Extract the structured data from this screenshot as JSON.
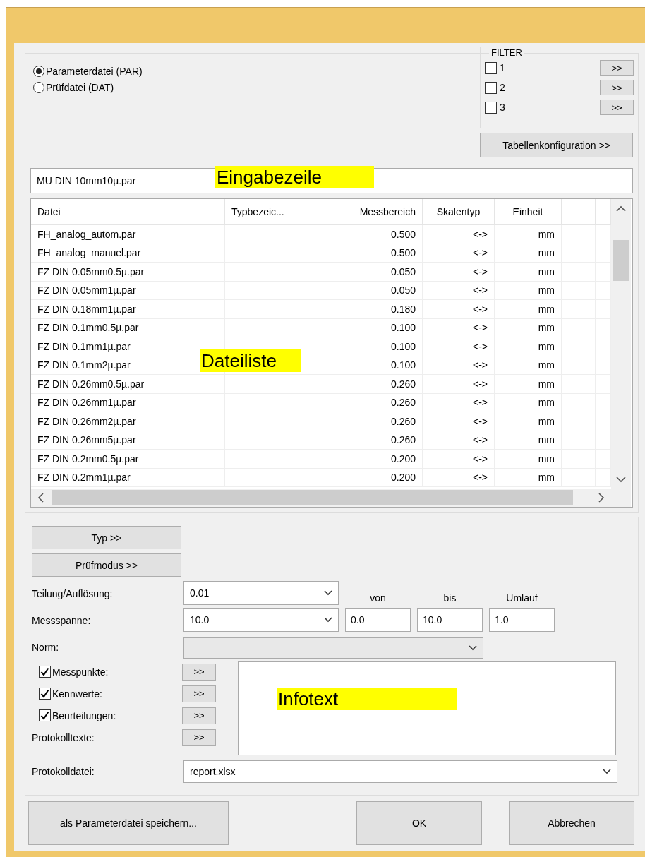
{
  "file_type": [
    {
      "label": "Parameterdatei (PAR)",
      "selected": true
    },
    {
      "label": "Prüfdatei (DAT)",
      "selected": false
    }
  ],
  "filter": {
    "title": "FILTER",
    "items": [
      {
        "label": "1",
        "checked": false,
        "button": ">>"
      },
      {
        "label": "2",
        "checked": false,
        "button": ">>"
      },
      {
        "label": "3",
        "checked": false,
        "button": ">>"
      }
    ]
  },
  "table_config_button": "Tabellenkonfiguration >>",
  "input_line": {
    "value": "MU DIN 10mm10µ.par"
  },
  "table": {
    "columns": [
      {
        "label": "Datei",
        "kind": "text"
      },
      {
        "label": "Typbezeic...",
        "kind": "text"
      },
      {
        "label": "Messbereich",
        "kind": "number"
      },
      {
        "label": "Skalentyp",
        "kind": "symbol"
      },
      {
        "label": "Einheit",
        "kind": "symbol"
      },
      {
        "kind": "text"
      }
    ],
    "rows": [
      [
        "FH_analog_autom.par",
        "",
        "0.500",
        "<->",
        "mm",
        ""
      ],
      [
        "FH_analog_manuel.par",
        "",
        "0.500",
        "<->",
        "mm",
        ""
      ],
      [
        "FZ DIN 0.05mm0.5µ.par",
        "",
        "0.050",
        "<->",
        "mm",
        ""
      ],
      [
        "FZ DIN 0.05mm1µ.par",
        "",
        "0.050",
        "<->",
        "mm",
        ""
      ],
      [
        "FZ DIN 0.18mm1µ.par",
        "",
        "0.180",
        "<->",
        "mm",
        ""
      ],
      [
        "FZ DIN 0.1mm0.5µ.par",
        "",
        "0.100",
        "<->",
        "mm",
        ""
      ],
      [
        "FZ DIN 0.1mm1µ.par",
        "",
        "0.100",
        "<->",
        "mm",
        ""
      ],
      [
        "FZ DIN 0.1mm2µ.par",
        "",
        "0.100",
        "<->",
        "mm",
        ""
      ],
      [
        "FZ DIN 0.26mm0.5µ.par",
        "",
        "0.260",
        "<->",
        "mm",
        ""
      ],
      [
        "FZ DIN 0.26mm1µ.par",
        "",
        "0.260",
        "<->",
        "mm",
        ""
      ],
      [
        "FZ DIN 0.26mm2µ.par",
        "",
        "0.260",
        "<->",
        "mm",
        ""
      ],
      [
        "FZ DIN 0.26mm5µ.par",
        "",
        "0.260",
        "<->",
        "mm",
        ""
      ],
      [
        "FZ DIN 0.2mm0.5µ.par",
        "",
        "0.200",
        "<->",
        "mm",
        ""
      ],
      [
        "FZ DIN 0.2mm1µ.par",
        "",
        "0.200",
        "<->",
        "mm",
        ""
      ]
    ]
  },
  "annotations": [
    {
      "text": "Eingabezeile",
      "kind": "input_line"
    },
    {
      "text": "Dateiliste",
      "kind": "file_list"
    },
    {
      "text": "Infotext",
      "kind": "info_text"
    }
  ],
  "side_buttons": [
    "Typ >>",
    "Prüfmodus >>"
  ],
  "resolution": {
    "label": "Teilung/Auflösung:",
    "value": "0.01"
  },
  "span": {
    "label": "Messspanne:",
    "value": "10.0"
  },
  "range_fields": [
    {
      "label": "von",
      "value": "0.0"
    },
    {
      "label": "bis",
      "value": "10.0"
    },
    {
      "label": "Umlauf",
      "value": "1.0"
    }
  ],
  "norm": {
    "label": "Norm:",
    "disabled": true
  },
  "sections": [
    {
      "kind": "checkbox",
      "label": "Messpunkte:",
      "checked": true,
      "button": ">>"
    },
    {
      "kind": "checkbox",
      "label": "Kennwerte:",
      "checked": true,
      "button": ">>"
    },
    {
      "kind": "checkbox",
      "label": "Beurteilungen:",
      "checked": true,
      "button": ">>"
    },
    {
      "kind": "plain",
      "label": "Protokolltexte:",
      "button": ">>"
    }
  ],
  "report_file": {
    "label": "Protokolldatei:",
    "value": "report.xlsx"
  },
  "footer_buttons": [
    "als Parameterdatei speichern...",
    "OK",
    "Abbrechen"
  ]
}
